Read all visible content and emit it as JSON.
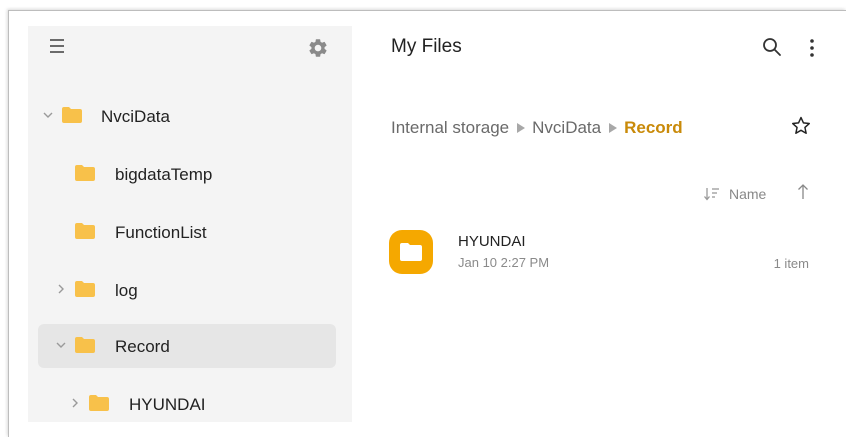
{
  "header": {
    "title": "My Files"
  },
  "sidebar": {
    "items": [
      {
        "label": "NvciData",
        "expander": "expanded"
      },
      {
        "label": "bigdataTemp",
        "expander": "none"
      },
      {
        "label": "FunctionList",
        "expander": "none"
      },
      {
        "label": "log",
        "expander": "collapsed"
      },
      {
        "label": "Record",
        "expander": "expanded",
        "selected": true
      },
      {
        "label": "HYUNDAI",
        "expander": "collapsed"
      }
    ]
  },
  "breadcrumb": {
    "items": [
      "Internal storage",
      "NvciData",
      "Record"
    ]
  },
  "sort": {
    "label": "Name"
  },
  "files": [
    {
      "name": "HYUNDAI",
      "date": "Jan 10 2:27 PM",
      "count": "1 item"
    }
  ],
  "icons": {
    "menu": "menu-icon",
    "settings": "gear-icon",
    "search": "search-icon",
    "more": "more-vertical-icon",
    "favorite": "star-outline-icon",
    "sort": "sort-icon",
    "sort_direction": "arrow-up-icon",
    "folder": "folder-icon"
  },
  "colors": {
    "folder": "#f8c14a",
    "folder_large": "#f5a800",
    "breadcrumb_current": "#c98a09",
    "sidebar_bg": "#f4f4f4",
    "selected_bg": "#e6e6e6"
  }
}
